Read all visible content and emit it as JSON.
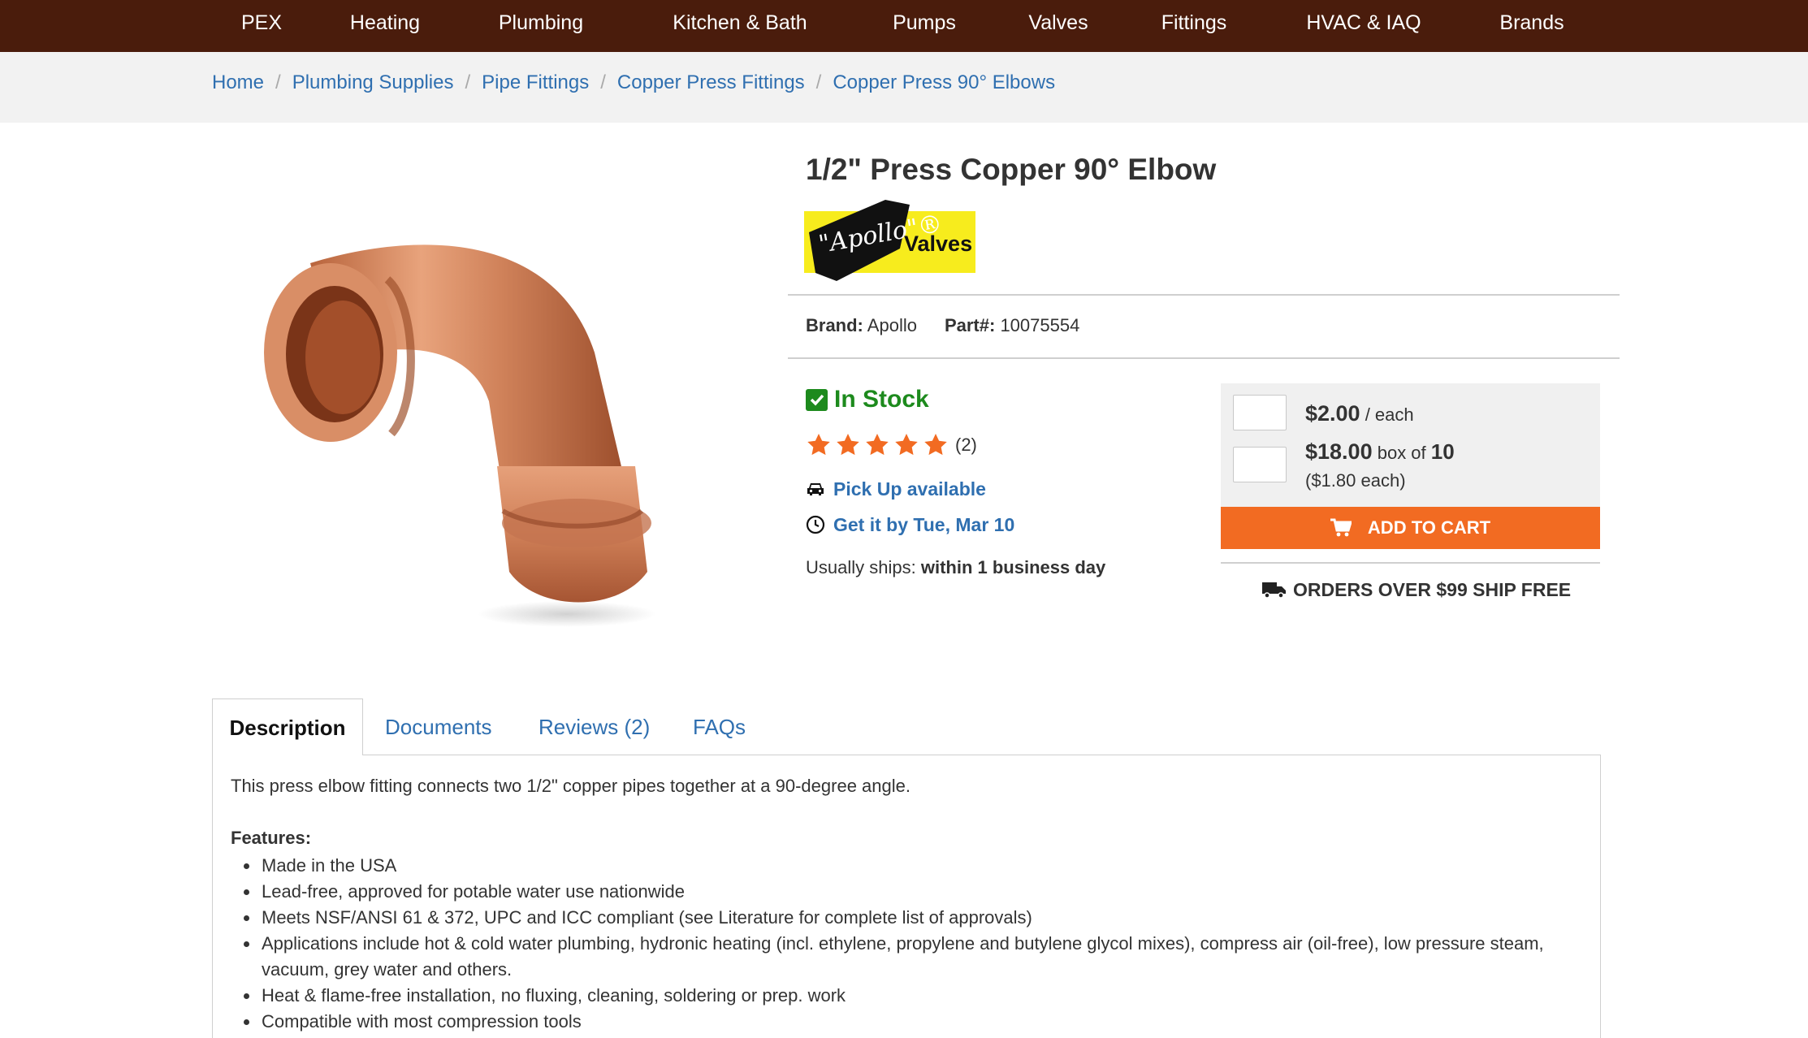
{
  "nav": {
    "items": [
      "PEX",
      "Heating",
      "Plumbing",
      "Kitchen & Bath",
      "Pumps",
      "Valves",
      "Fittings",
      "HVAC & IAQ",
      "Brands"
    ]
  },
  "breadcrumb": {
    "items": [
      "Home",
      "Plumbing Supplies",
      "Pipe Fittings",
      "Copper Press Fittings",
      "Copper Press 90° Elbows"
    ],
    "separator": "/"
  },
  "product": {
    "title": "1/2\" Press Copper 90° Elbow",
    "brand_logo": {
      "name": "Apollo",
      "suffix": "Valves",
      "mark": "\"Apollo\"®"
    },
    "brand_label": "Brand:",
    "brand_value": "Apollo",
    "part_label": "Part#:",
    "part_value": "10075554"
  },
  "availability": {
    "stock": "In Stock",
    "rating": 5,
    "review_count": "(2)",
    "pickup": "Pick Up available",
    "delivery": "Get it by Tue, Mar 10",
    "ships_label": "Usually ships:",
    "ships_value": "within 1 business day"
  },
  "buybox": {
    "price_each": "$2.00",
    "price_each_suffix": "/ each",
    "price_box": "$18.00",
    "price_box_prefix": "box of",
    "box_qty": "10",
    "price_box_unit": "($1.80 each)",
    "qty_each": "",
    "qty_box": "",
    "add_to_cart": "ADD TO CART",
    "ship_free": "ORDERS OVER $99 SHIP FREE"
  },
  "tabs": {
    "description": "Description",
    "documents": "Documents",
    "reviews": "Reviews (2)",
    "faqs": "FAQs"
  },
  "description": {
    "intro": "This press elbow fitting connects two 1/2\" copper pipes together at a 90-degree angle.",
    "features_heading": "Features:",
    "features": [
      "Made in the USA",
      "Lead-free, approved for potable water use nationwide",
      "Meets NSF/ANSI 61 & 372, UPC and ICC compliant (see Literature for complete list of approvals)",
      "Applications include hot & cold water plumbing, hydronic heating (incl. ethylene, propylene and butylene glycol mixes), compress air (oil-free), low pressure steam, vacuum, grey water and others.",
      "Heat & flame-free installation, no fluxing, cleaning, soldering or prep. work",
      "Compatible with most compression tools"
    ]
  },
  "colors": {
    "nav_bg": "#4a1c0c",
    "link": "#2f6fb0",
    "stock_green": "#1d8a1d",
    "cta_orange": "#f26b22",
    "star_orange": "#f26b22",
    "logo_yellow": "#f7ec1d"
  }
}
